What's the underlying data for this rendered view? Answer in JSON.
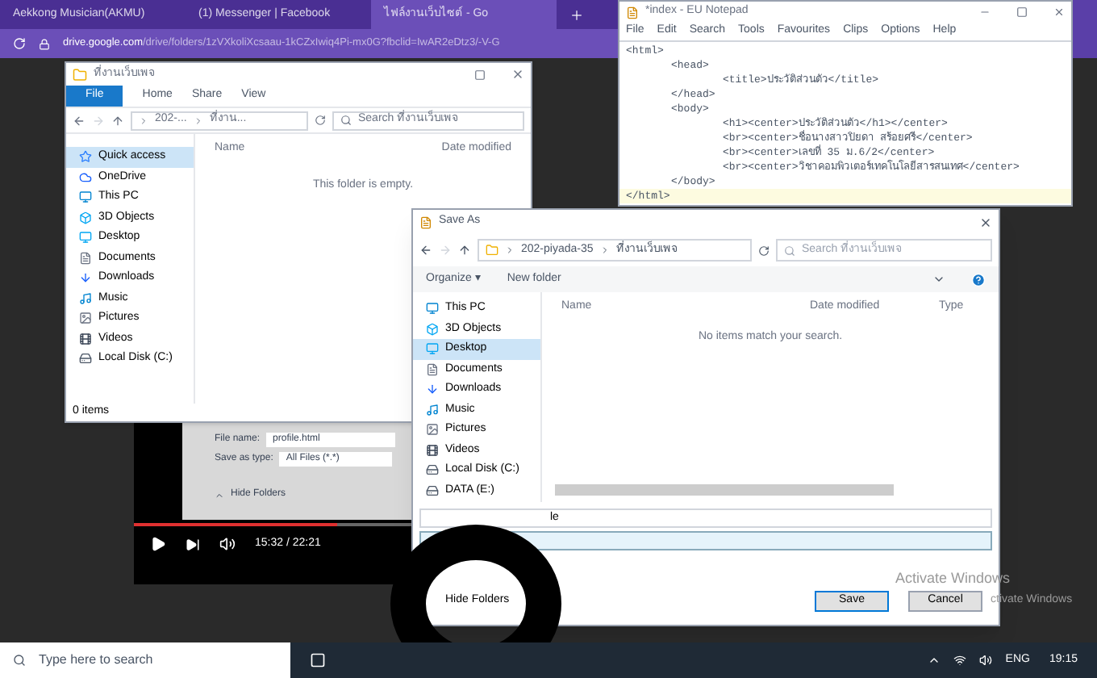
{
  "browser": {
    "tabs": [
      {
        "label": "Aekkong Musician(AKMU)",
        "selected": false
      },
      {
        "label": "(1) Messenger | Facebook",
        "selected": false
      },
      {
        "label": "ไฟล์งานเว็บไซต์ - Go",
        "selected": true
      }
    ],
    "url_host": "drive.google.com",
    "url_path": "/drive/folders/1zVXkoliXcsaau-1kCZxIwiq4Pi-mx0G?fbclid=IwAR2eDtz3/-V-G"
  },
  "explorer": {
    "title": "ที่งานเว็บเพจ",
    "ribbon_tabs": [
      {
        "label": "File",
        "selected": true
      },
      {
        "label": "Home",
        "selected": false
      },
      {
        "label": "Share",
        "selected": false
      },
      {
        "label": "View",
        "selected": false
      }
    ],
    "path": [
      "202-...",
      "ที่งาน..."
    ],
    "search_placeholder": "Search ที่งานเว็บเพจ",
    "columns": [
      "Name",
      "Date modified"
    ],
    "empty_text": "This folder is empty.",
    "nav": [
      {
        "label": "Quick access",
        "selected": true
      },
      {
        "label": "OneDrive",
        "selected": false
      },
      {
        "label": "This PC",
        "selected": false
      },
      {
        "label": "3D Objects",
        "selected": false
      },
      {
        "label": "Desktop",
        "selected": false
      },
      {
        "label": "Documents",
        "selected": false
      },
      {
        "label": "Downloads",
        "selected": false
      },
      {
        "label": "Music",
        "selected": false
      },
      {
        "label": "Pictures",
        "selected": false
      },
      {
        "label": "Videos",
        "selected": false
      },
      {
        "label": "Local Disk (C:)",
        "selected": false
      }
    ],
    "status": "0 items"
  },
  "notepad": {
    "title": "*index - EU Notepad",
    "menu": [
      "File",
      "Edit",
      "Search",
      "Tools",
      "Favourites",
      "Clips",
      "Options",
      "Help"
    ],
    "lines": [
      {
        "text": "<html>",
        "children": [
          {
            "text": "<head>",
            "children": [
              {
                "text": "<title>ประวัติส่วนตัว</title>"
              }
            ]
          },
          {
            "text": "</head>"
          },
          {
            "text": "<body>",
            "children": [
              {
                "text": "<h1><center>ประวัติส่วนตัว</h1></center>"
              },
              {
                "text": "<br><center>ชื่อนางสาวปิยดา สร้อยศรี</center>"
              },
              {
                "text": "<br><center>เลขที่ 35 ม.6/2</center>"
              },
              {
                "text": "<br><center>วิชาคอมพิวเตอร์เทคโนโลยีสารสนเทศ</center>"
              }
            ]
          },
          {
            "text": "</body>"
          }
        ]
      },
      {
        "text": "</html>"
      }
    ]
  },
  "video": {
    "file_name_label": "File name:",
    "file_name": "profile.html",
    "type_label": "Save as type:",
    "type_value": "All Files (*.*)",
    "hide_folders": "Hide Folders",
    "level": 0.7,
    "time": "15:32 / 22:21"
  },
  "save_as": {
    "title": "Save As",
    "path": [
      "202-piyada-35",
      "ที่งานเว็บเพจ"
    ],
    "search_placeholder": "Search ที่งานเว็บเพจ",
    "organize": "Organize ▾",
    "new_folder": "New folder",
    "nav": [
      {
        "label": "This PC",
        "selected": false
      },
      {
        "label": "3D Objects",
        "selected": false
      },
      {
        "label": "Desktop",
        "selected": true
      },
      {
        "label": "Documents",
        "selected": false
      },
      {
        "label": "Downloads",
        "selected": false
      },
      {
        "label": "Music",
        "selected": false
      },
      {
        "label": "Pictures",
        "selected": false
      },
      {
        "label": "Videos",
        "selected": false
      },
      {
        "label": "Local Disk (C:)",
        "selected": false
      },
      {
        "label": "DATA (E:)",
        "selected": false
      }
    ],
    "columns": [
      "Name",
      "Date modified",
      "Type"
    ],
    "empty_text": "No items match your search.",
    "file_name": "le",
    "hide_folders": "Hide Folders",
    "buttons": [
      "Save",
      "Cancel"
    ]
  },
  "activation": [
    "Activate Windows",
    "ctivate Windows"
  ],
  "taskbar": {
    "search_placeholder": "Type here to search",
    "tray": "ENG",
    "time": "19:15"
  }
}
